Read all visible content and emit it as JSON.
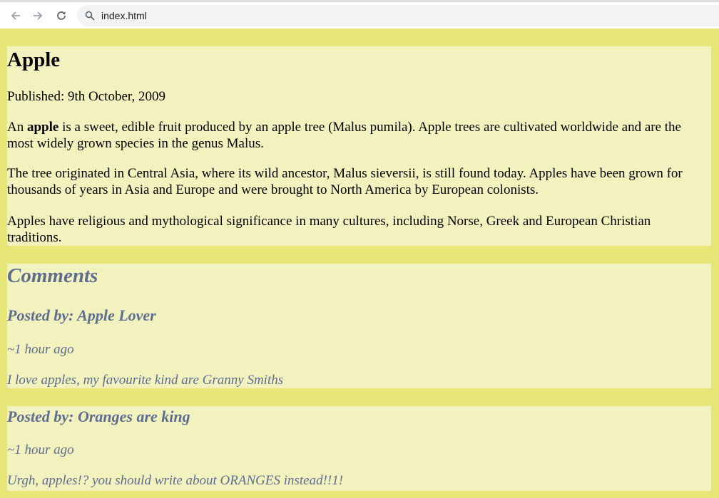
{
  "browser": {
    "url": "index.html",
    "icons": {
      "back": "arrow-left-icon",
      "forward": "arrow-right-icon",
      "reload": "reload-icon",
      "search": "search-icon"
    }
  },
  "colors": {
    "page_background": "#e6e677",
    "box_background": "#f2f2bf",
    "comment_text": "#5e6d8f"
  },
  "article": {
    "title": "Apple",
    "published": "Published: 9th October, 2009",
    "p1_start": "An ",
    "p1_bold": "apple",
    "p1_end": " is a sweet, edible fruit produced by an apple tree (Malus pumila). Apple trees are cultivated worldwide and are the most widely grown species in the genus Malus.",
    "p2": "The tree originated in Central Asia, where its wild ancestor, Malus sieversii, is still found today. Apples have been grown for thousands of years in Asia and Europe and were brought to North America by European colonists.",
    "p3": "Apples have religious and mythological significance in many cultures, including Norse, Greek and European Christian traditions."
  },
  "comments": {
    "heading": "Comments",
    "items": [
      {
        "posted_by": "Posted by: Apple Lover",
        "time": "~1 hour ago",
        "text": "I love apples, my favourite kind are Granny Smiths"
      },
      {
        "posted_by": "Posted by: Oranges are king",
        "time": "~1 hour ago",
        "text": "Urgh, apples!? you should write about ORANGES instead!!1!"
      }
    ]
  }
}
